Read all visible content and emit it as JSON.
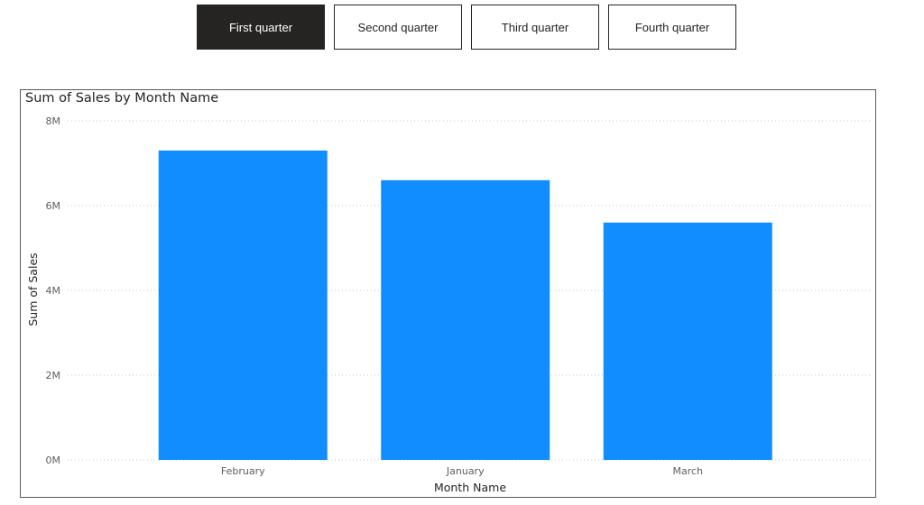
{
  "slicer": {
    "buttons": [
      {
        "label": "First quarter",
        "selected": true
      },
      {
        "label": "Second quarter",
        "selected": false
      },
      {
        "label": "Third quarter",
        "selected": false
      },
      {
        "label": "Fourth quarter",
        "selected": false
      }
    ]
  },
  "colors": {
    "bar": "#118DFF",
    "selected_bg": "#252423",
    "text": "#252423",
    "axis_text": "#605E5C",
    "gridline": "#C8C6C4"
  },
  "chart_data": {
    "type": "bar",
    "title": "Sum of Sales by Month Name",
    "xlabel": "Month Name",
    "ylabel": "Sum of Sales",
    "categories": [
      "February",
      "January",
      "March"
    ],
    "values": [
      7300000,
      6600000,
      5600000
    ],
    "ylim": [
      0,
      8000000
    ],
    "yticks": [
      0,
      2000000,
      4000000,
      6000000,
      8000000
    ],
    "ytick_labels": [
      "0M",
      "2M",
      "4M",
      "6M",
      "8M"
    ],
    "grid": true,
    "legend": "none"
  }
}
